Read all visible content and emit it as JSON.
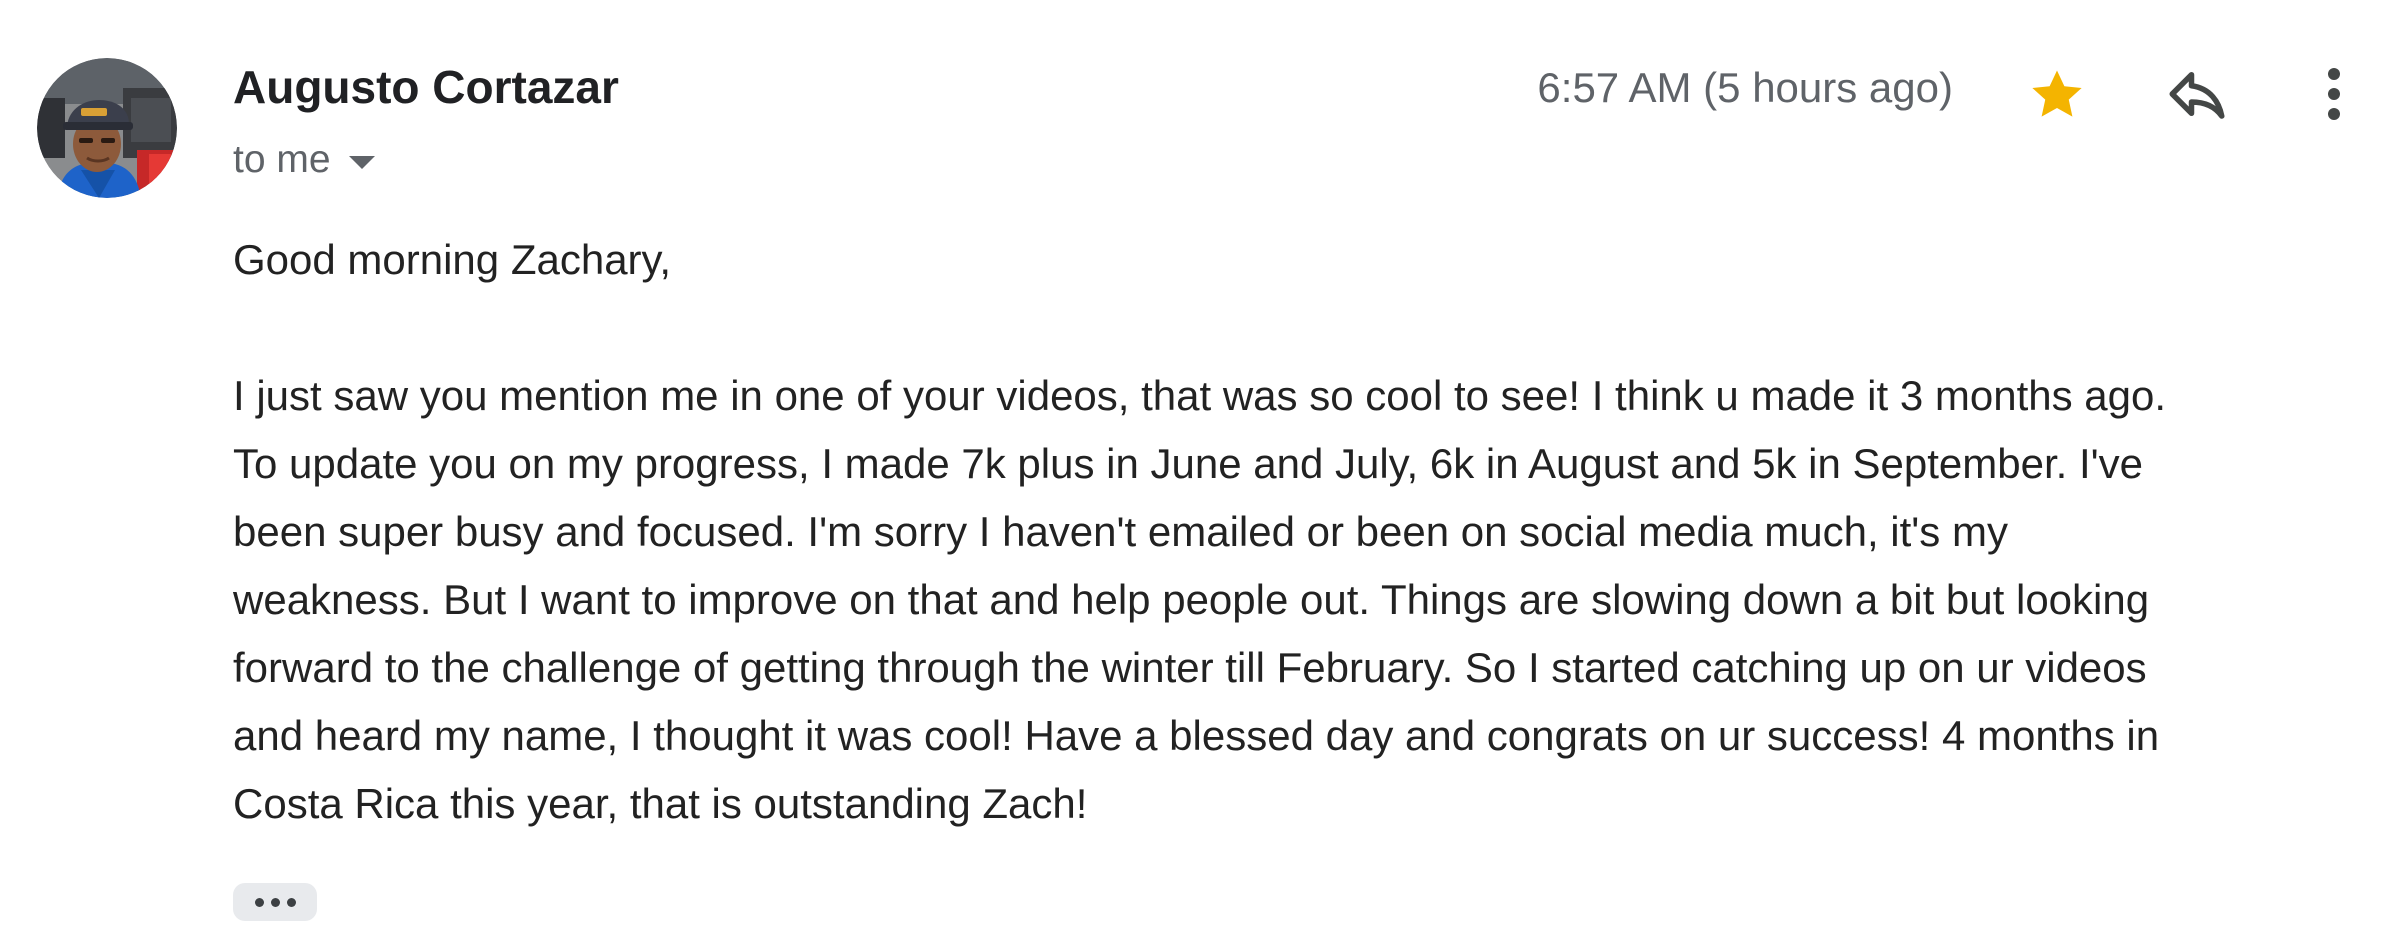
{
  "sender": {
    "name": "Augusto Cortazar",
    "recipient_label": "to me"
  },
  "header": {
    "timestamp": "6:57 AM (5 hours ago)",
    "starred": true,
    "star_color": "#f4b400",
    "icons": [
      "star-icon",
      "reply-icon",
      "more-vert-icon"
    ]
  },
  "message": {
    "greeting": "Good morning Zachary,",
    "lines": [
      "I just saw you mention me in one of your videos, that was so cool to see! I think u made it 3 months ago.",
      "To update you on my progress, I made 7k plus in June and July, 6k in August and 5k in September. I've",
      "been super busy and focused. I'm sorry I haven't emailed or been on social media much, it's my",
      "weakness. But I want to improve on that and help people out. Things are slowing down a bit but looking",
      "forward to the challenge of getting through the winter till February. So I started catching up on ur videos",
      "and heard my name, I thought it was cool! Have a blessed day and congrats on ur success! 4 months in",
      "Costa Rica this year, that is outstanding Zach!"
    ]
  }
}
